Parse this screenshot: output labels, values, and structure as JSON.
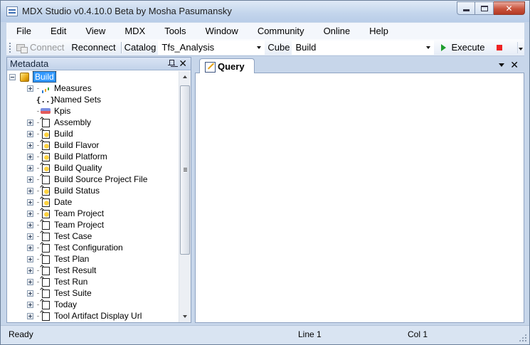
{
  "window": {
    "title": "MDX Studio v0.4.10.0 Beta by Mosha Pasumansky"
  },
  "menu": [
    "File",
    "Edit",
    "View",
    "MDX",
    "Tools",
    "Window",
    "Community",
    "Online",
    "Help"
  ],
  "toolbar": {
    "connect_label": "Connect",
    "reconnect_label": "Reconnect",
    "catalog_label": "Catalog",
    "catalog_value": "Tfs_Analysis",
    "cube_label": "Cube",
    "cube_value": "Build",
    "execute_label": "Execute"
  },
  "metadata": {
    "title": "Metadata",
    "root": "Build",
    "items": [
      {
        "label": "Measures",
        "icon": "measures-icon",
        "expandable": true
      },
      {
        "label": "Named Sets",
        "icon": "named-sets-icon",
        "expandable": false
      },
      {
        "label": "Kpis",
        "icon": "kpi-icon",
        "expandable": false
      },
      {
        "label": "Assembly",
        "icon": "dimension-icon",
        "expandable": true
      },
      {
        "label": "Build",
        "icon": "dimension-gold-icon",
        "expandable": true
      },
      {
        "label": "Build Flavor",
        "icon": "dimension-gold-icon",
        "expandable": true
      },
      {
        "label": "Build Platform",
        "icon": "dimension-gold-icon",
        "expandable": true
      },
      {
        "label": "Build Quality",
        "icon": "dimension-gold-icon",
        "expandable": true
      },
      {
        "label": "Build Source Project File",
        "icon": "dimension-icon",
        "expandable": true
      },
      {
        "label": "Build Status",
        "icon": "dimension-gold-icon",
        "expandable": true
      },
      {
        "label": "Date",
        "icon": "dimension-gold-icon",
        "expandable": true
      },
      {
        "label": "Team Project",
        "icon": "dimension-gold-icon",
        "expandable": true
      },
      {
        "label": "Team Project",
        "icon": "dimension-icon",
        "expandable": true
      },
      {
        "label": "Test Case",
        "icon": "dimension-icon",
        "expandable": true
      },
      {
        "label": "Test Configuration",
        "icon": "dimension-icon",
        "expandable": true
      },
      {
        "label": "Test Plan",
        "icon": "dimension-icon",
        "expandable": true
      },
      {
        "label": "Test Result",
        "icon": "dimension-icon",
        "expandable": true
      },
      {
        "label": "Test Run",
        "icon": "dimension-icon",
        "expandable": true
      },
      {
        "label": "Test Suite",
        "icon": "dimension-icon",
        "expandable": true
      },
      {
        "label": "Today",
        "icon": "dimension-icon",
        "expandable": true
      },
      {
        "label": "Tool Artifact Display Url",
        "icon": "dimension-icon",
        "expandable": true
      }
    ]
  },
  "document": {
    "tab_label": "Query"
  },
  "status": {
    "state": "Ready",
    "line": "Line 1",
    "col": "Col 1"
  },
  "colors": {
    "chrome": "#c7d6ea",
    "selection": "#3399ff",
    "execute_green": "#1e9d2d",
    "stop_red": "#e22222"
  }
}
